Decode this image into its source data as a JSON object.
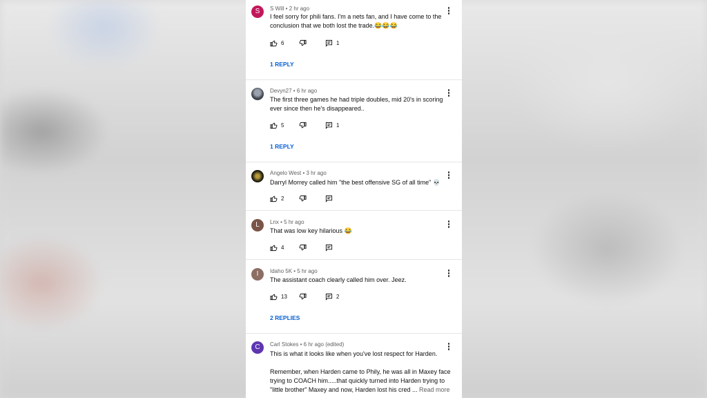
{
  "comments": [
    {
      "author": "S Will",
      "time": "2 hr ago",
      "avatar_letter": "S",
      "avatar_color": "#c2185b",
      "text": "I feel sorry for phili fans. I'm a nets fan, and I have come to the conclusion that we both lost the trade.😂😂😂",
      "likes": "6",
      "reply_count": "1",
      "replies_link": "1 REPLY"
    },
    {
      "author": "Devyn27",
      "time": "6 hr ago",
      "avatar_letter": "",
      "avatar_color": "#4a5058",
      "text": "The first three games he had triple doubles, mid 20's in scoring ever since then he's disappeared..",
      "likes": "5",
      "reply_count": "1",
      "replies_link": "1 REPLY"
    },
    {
      "author": "Angelo West",
      "time": "3 hr ago",
      "avatar_letter": "",
      "avatar_color": "#2b2a1c",
      "text": "Darryl Morrey called him \"the best offensive SG of all time\" 💀",
      "likes": "2",
      "reply_count": "",
      "replies_link": ""
    },
    {
      "author": "Lnx",
      "time": "5 hr ago",
      "avatar_letter": "L",
      "avatar_color": "#795548",
      "text": "That was low key hilarious 😂",
      "likes": "4",
      "reply_count": "",
      "replies_link": ""
    },
    {
      "author": "Idaho 5K",
      "time": "5 hr ago",
      "avatar_letter": "I",
      "avatar_color": "#8d6e63",
      "text": "The assistant coach clearly called him over. Jeez.",
      "likes": "13",
      "reply_count": "2",
      "replies_link": "2 REPLIES"
    },
    {
      "author": "Carl Stokes",
      "time": "6 hr ago (edited)",
      "avatar_letter": "C",
      "avatar_color": "#5e35b1",
      "text": "This is what it looks like when you've lost respect for Harden.",
      "text2": "Remember, when Harden came to Phily, he was all in Maxey face trying to COACH him.....that quickly turned into Harden trying to \"little brother\" Maxey and now, Harden lost his cred ...",
      "read_more": "Read more"
    }
  ],
  "icons": {
    "like": "thumb-up-icon",
    "dislike": "thumb-down-icon",
    "reply": "comment-reply-icon",
    "more": "more-vert-icon"
  }
}
